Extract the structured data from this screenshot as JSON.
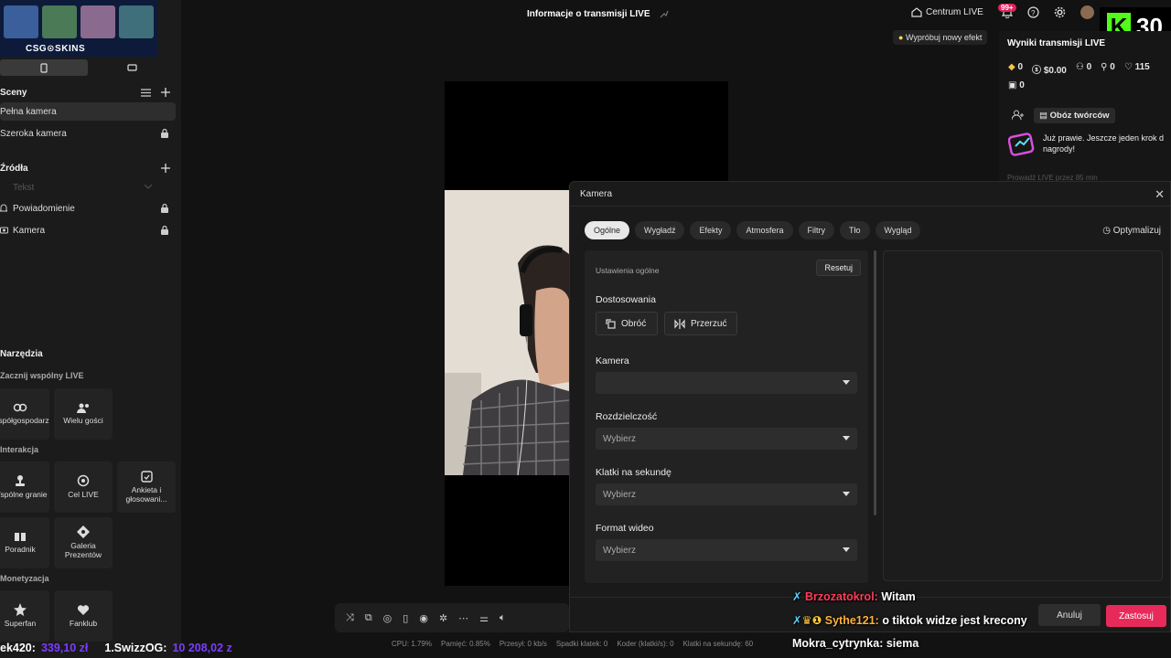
{
  "sidebar": {
    "brand": "CSG⊙SKINS",
    "scenes_title": "Sceny",
    "scenes": [
      {
        "label": "Pełna kamera",
        "active": true
      },
      {
        "label": "Szeroka kamera",
        "locked": true
      }
    ],
    "sources_title": "Źródła",
    "sources": [
      {
        "label": "Tekst",
        "faded": true
      },
      {
        "label": "Powiadomienie",
        "locked": true
      },
      {
        "label": "Kamera",
        "locked": true
      }
    ],
    "tools_title": "Narzędzia",
    "multi_title": "Zacznij wspólny LIVE",
    "multi_tools": [
      "Współgospodarz",
      "Wielu gości"
    ],
    "interaction_title": "Interakcja",
    "interaction_tools": [
      "Wspólne granie",
      "Cel LIVE",
      "Ankieta i głosowani...",
      "Poradnik",
      "Galeria Prezentów"
    ],
    "monetization_title": "Monetyzacja",
    "monetization_tools": [
      "Superfan",
      "Fanklub"
    ]
  },
  "header": {
    "title": "Informacje o transmisji LIVE",
    "center_link": "Centrum LIVE",
    "notif_count": "99+",
    "kick_number": "30",
    "effect_hint": "Wypróbuj nowy efekt"
  },
  "results": {
    "title": "Wyniki transmisji LIVE",
    "diamonds": "0",
    "money": "$0.00",
    "viewers": "0",
    "shares": "0",
    "likes": "115",
    "gifts": "0",
    "creator_camp": "Obóz twórców",
    "promo_text": "Już prawie. Jeszcze jeden krok d nagrody!",
    "faded_text": "Prowadź LIVE przez 85 min"
  },
  "status_bar": {
    "cpu": "CPU: 1.79%",
    "memory": "Pamięć: 0.85%",
    "bandwidth": "Przesył: 0 kb/s",
    "dropped": "Spadki klatek: 0",
    "encoder": "Koder (klatki/s): 0",
    "fps": "Klatki na sekundę: 60"
  },
  "dialog": {
    "title": "Kamera",
    "tabs": [
      "Ogólne",
      "Wygładź",
      "Efekty",
      "Atmosfera",
      "Filtry",
      "Tło",
      "Wygląd"
    ],
    "optimize": "Optymalizuj",
    "general_settings": "Ustawienia ogólne",
    "reset": "Resetuj",
    "adjustments": "Dostosowania",
    "rotate": "Obróć",
    "flip": "Przerzuć",
    "camera_label": "Kamera",
    "camera_value": "",
    "resolution_label": "Rozdzielczość",
    "resolution_placeholder": "Wybierz",
    "fps_label": "Klatki na sekundę",
    "fps_placeholder": "Wybierz",
    "format_label": "Format wideo",
    "format_placeholder": "Wybierz",
    "cancel": "Anuluj",
    "apply": "Zastosuj"
  },
  "chat": [
    {
      "user": "Brzozatokrol:",
      "message": "Witam"
    },
    {
      "user": "Sythe121:",
      "message": "o tiktok widze jest krecony"
    },
    {
      "user": "Mokra_cytrynka:",
      "message": "siema"
    }
  ],
  "ticker": [
    {
      "name": "ek420:",
      "amount": "339,10 zł"
    },
    {
      "name": "1.SwizzOG:",
      "amount": "10 208,02 z"
    }
  ],
  "colors": {
    "accent": "#e82a5a",
    "kick_green": "#53fc18",
    "ticker_amount": "#7b3cff"
  }
}
